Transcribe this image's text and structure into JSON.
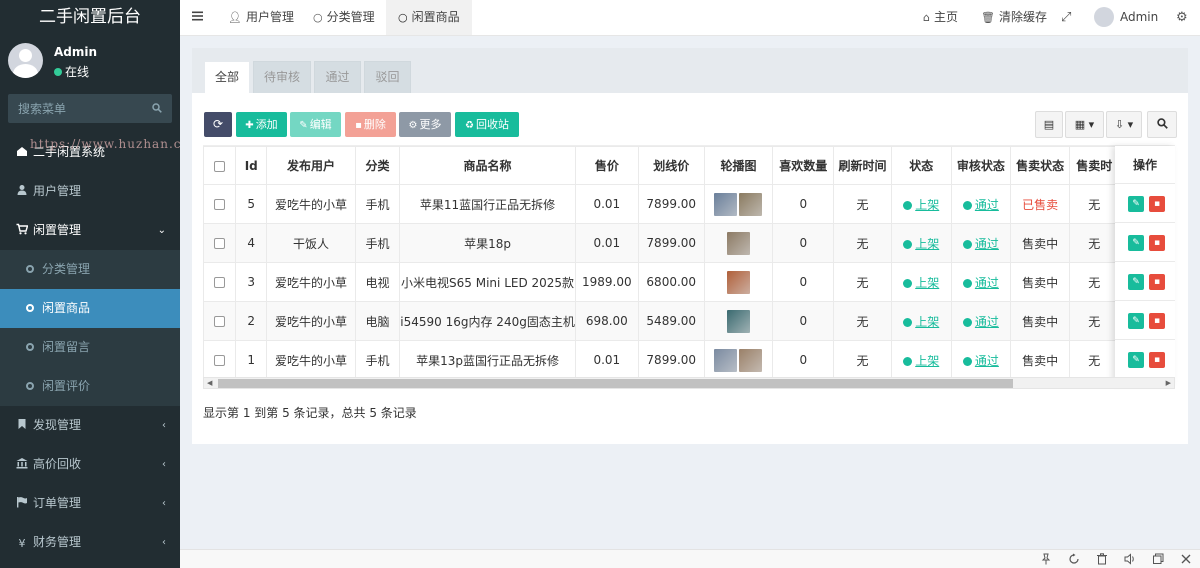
{
  "sidebar": {
    "logo": "二手闲置后台",
    "user_name": "Admin",
    "user_status": "在线",
    "search_placeholder": "搜索菜单",
    "watermark": "https://www.huzhan.com/ishop42659",
    "menu": [
      {
        "label": "二手闲置系统",
        "icon": "dashboard-icon"
      },
      {
        "label": "用户管理",
        "icon": "user-icon"
      },
      {
        "label": "闲置管理",
        "icon": "cart-icon"
      },
      {
        "label": "分类管理"
      },
      {
        "label": "闲置商品"
      },
      {
        "label": "闲置留言"
      },
      {
        "label": "闲置评价"
      },
      {
        "label": "发现管理",
        "icon": "bookmark-icon"
      },
      {
        "label": "高价回收",
        "icon": "bank-icon"
      },
      {
        "label": "订单管理",
        "icon": "flag-icon"
      },
      {
        "label": "财务管理",
        "icon": "yen-icon"
      }
    ]
  },
  "header": {
    "tabs": [
      "用户管理",
      "分类管理",
      "闲置商品"
    ],
    "home": "主页",
    "clear_cache": "清除缓存",
    "admin": "Admin"
  },
  "content": {
    "tabs": [
      "全部",
      "待审核",
      "通过",
      "驳回"
    ],
    "toolbar": {
      "add": "添加",
      "edit": "编辑",
      "delete": "删除",
      "more": "更多",
      "recycle": "回收站"
    },
    "columns": [
      "Id",
      "发布用户",
      "分类",
      "商品名称",
      "售价",
      "划线价",
      "轮播图",
      "喜欢数量",
      "刷新时间",
      "状态",
      "审核状态",
      "售卖状态",
      "售卖时",
      "操作"
    ],
    "rows": [
      {
        "id": "5",
        "user": "爱吃牛的小草",
        "category": "手机",
        "name": "苹果11蓝国行正品无拆修",
        "price": "0.01",
        "line_price": "7899.00",
        "likes": "0",
        "refresh": "无",
        "status": "上架",
        "review": "通过",
        "sale": "已售卖",
        "sale_time": "无",
        "thumbs": [
          "#6a7f9a",
          "#8a7a60"
        ]
      },
      {
        "id": "4",
        "user": "干饭人",
        "category": "手机",
        "name": "苹果18p",
        "price": "0.01",
        "line_price": "7899.00",
        "likes": "0",
        "refresh": "无",
        "status": "上架",
        "review": "通过",
        "sale": "售卖中",
        "sale_time": "无",
        "thumbs": [
          "#8c7a64"
        ]
      },
      {
        "id": "3",
        "user": "爱吃牛的小草",
        "category": "电视",
        "name": "小米电视S65 Mini LED 2025款",
        "price": "1989.00",
        "line_price": "6800.00",
        "likes": "0",
        "refresh": "无",
        "status": "上架",
        "review": "通过",
        "sale": "售卖中",
        "sale_time": "无",
        "thumbs": [
          "#b0603a"
        ]
      },
      {
        "id": "2",
        "user": "爱吃牛的小草",
        "category": "电脑",
        "name": "i54590 16g内存 240g固态主机",
        "price": "698.00",
        "line_price": "5489.00",
        "likes": "0",
        "refresh": "无",
        "status": "上架",
        "review": "通过",
        "sale": "售卖中",
        "sale_time": "无",
        "thumbs": [
          "#3a6a70"
        ]
      },
      {
        "id": "1",
        "user": "爱吃牛的小草",
        "category": "手机",
        "name": "苹果13p蓝国行正品无拆修",
        "price": "0.01",
        "line_price": "7899.00",
        "likes": "0",
        "refresh": "无",
        "status": "上架",
        "review": "通过",
        "sale": "售卖中",
        "sale_time": "无",
        "thumbs": [
          "#7a8aa0",
          "#9a8068"
        ]
      }
    ],
    "summary": "显示第 1 到第 5 条记录，总共 5 条记录"
  },
  "colors": {
    "sidebar_bg": "#222d32",
    "active": "#3c8dbc",
    "success": "#18bc9c",
    "danger": "#e74c3c"
  }
}
